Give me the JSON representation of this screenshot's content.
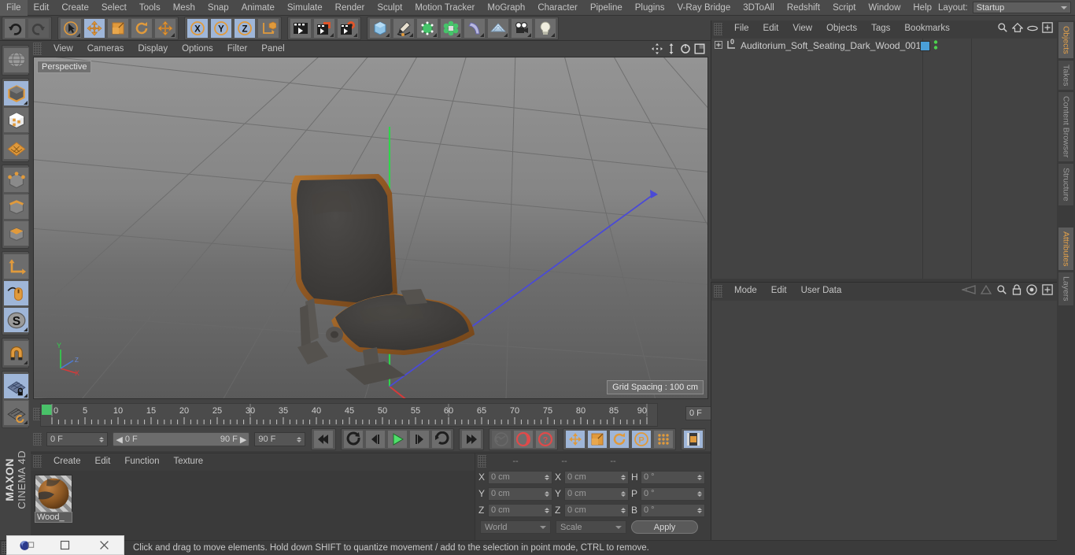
{
  "menubar": {
    "items": [
      "File",
      "Edit",
      "Create",
      "Select",
      "Tools",
      "Mesh",
      "Snap",
      "Animate",
      "Simulate",
      "Render",
      "Sculpt",
      "Motion Tracker",
      "MoGraph",
      "Character",
      "Pipeline",
      "Plugins",
      "V-Ray Bridge",
      "3DToAll",
      "Redshift",
      "Script",
      "Window",
      "Help"
    ],
    "layout_label": "Layout:",
    "layout_value": "Startup",
    "search_icon": "search-icon"
  },
  "toolbar": {
    "groups": [
      {
        "name": "history",
        "buttons": [
          {
            "icon": "undo-icon",
            "active": false,
            "disabled": false,
            "corner": false
          },
          {
            "icon": "redo-icon",
            "active": false,
            "disabled": true,
            "corner": false
          }
        ]
      },
      {
        "name": "tools",
        "buttons": [
          {
            "icon": "live-selection-icon",
            "active": false,
            "disabled": false,
            "corner": true
          },
          {
            "icon": "move-tool-icon",
            "active": true,
            "disabled": false,
            "corner": false
          },
          {
            "icon": "scale-tool-icon",
            "active": false,
            "disabled": false,
            "corner": false
          },
          {
            "icon": "rotate-tool-icon",
            "active": false,
            "disabled": false,
            "corner": false
          },
          {
            "icon": "move-alt-icon",
            "active": false,
            "disabled": false,
            "corner": true
          }
        ]
      },
      {
        "name": "axis-locks",
        "buttons": [
          {
            "icon": "axis-x-icon",
            "active": true,
            "disabled": false,
            "corner": false
          },
          {
            "icon": "axis-y-icon",
            "active": true,
            "disabled": false,
            "corner": false
          },
          {
            "icon": "axis-z-icon",
            "active": true,
            "disabled": false,
            "corner": false
          },
          {
            "icon": "world-coordinate-icon",
            "active": false,
            "disabled": false,
            "corner": false
          }
        ]
      },
      {
        "name": "render",
        "buttons": [
          {
            "icon": "render-view-icon",
            "active": false,
            "disabled": false,
            "corner": false
          },
          {
            "icon": "render-to-picture-viewer-icon",
            "active": false,
            "disabled": false,
            "corner": true
          },
          {
            "icon": "render-settings-icon",
            "active": false,
            "disabled": false,
            "corner": true
          }
        ]
      },
      {
        "name": "objects",
        "buttons": [
          {
            "icon": "cube-primitive-icon",
            "active": false,
            "disabled": false,
            "corner": true
          },
          {
            "icon": "spline-pen-icon",
            "active": false,
            "disabled": false,
            "corner": true
          },
          {
            "icon": "generator-nurbs-icon",
            "active": false,
            "disabled": false,
            "corner": true
          },
          {
            "icon": "mograph-cloner-icon",
            "active": false,
            "disabled": false,
            "corner": true
          },
          {
            "icon": "deformer-bend-icon",
            "active": false,
            "disabled": false,
            "corner": true
          },
          {
            "icon": "floor-scene-icon",
            "active": false,
            "disabled": false,
            "corner": true
          },
          {
            "icon": "camera-icon",
            "active": false,
            "disabled": false,
            "corner": true
          },
          {
            "icon": "light-icon",
            "active": false,
            "disabled": false,
            "corner": true
          }
        ]
      }
    ]
  },
  "leftbar": {
    "groups": [
      {
        "buttons": [
          {
            "icon": "make-editable-icon",
            "active": false,
            "corner": false
          }
        ]
      },
      {
        "buttons": [
          {
            "icon": "model-mode-icon",
            "active": true,
            "corner": true
          },
          {
            "icon": "texture-mode-icon",
            "active": false,
            "corner": false
          },
          {
            "icon": "polygon-mode-icon",
            "active": false,
            "corner": false
          }
        ]
      },
      {
        "buttons": [
          {
            "icon": "point-mode-icon",
            "active": false,
            "corner": false
          },
          {
            "icon": "edge-mode-icon",
            "active": false,
            "corner": false
          },
          {
            "icon": "polygon-face-mode-icon",
            "active": false,
            "corner": false
          }
        ]
      },
      {
        "buttons": [
          {
            "icon": "object-axis-icon",
            "active": false,
            "corner": false
          },
          {
            "icon": "viewport-solo-icon",
            "active": true,
            "corner": false
          },
          {
            "icon": "enable-snap-icon",
            "active": true,
            "corner": true
          }
        ]
      },
      {
        "buttons": [
          {
            "icon": "magnet-icon",
            "active": false,
            "corner": true
          }
        ]
      },
      {
        "buttons": [
          {
            "icon": "workplane-lock-icon",
            "active": true,
            "corner": true
          },
          {
            "icon": "workplane-rotate-icon",
            "active": false,
            "corner": true
          }
        ]
      }
    ],
    "brand_top": "MAXON",
    "brand_bottom": "CINEMA 4D"
  },
  "viewport": {
    "menu_items": [
      "View",
      "Cameras",
      "Display",
      "Options",
      "Filter",
      "Panel"
    ],
    "nav_icons": [
      "pan-viewport-icon",
      "zoom-viewport-icon",
      "rotate-viewport-icon",
      "maximize-viewport-icon"
    ],
    "label": "Perspective",
    "grid_spacing": "Grid Spacing : 100 cm",
    "axis_labels": {
      "y": "Y",
      "z": "Z",
      "x": "X"
    }
  },
  "timeline": {
    "ticks": [
      0,
      5,
      10,
      15,
      20,
      25,
      30,
      35,
      40,
      45,
      50,
      55,
      60,
      65,
      70,
      75,
      80,
      85,
      90
    ],
    "current_frame_field": "0 F"
  },
  "transport": {
    "current_frame": "0 F",
    "range_start": "0 F",
    "range_end": "90 F",
    "end_frame": "90 F",
    "buttons": [
      {
        "icon": "go-to-start-icon",
        "active": false,
        "disabled": false
      },
      {
        "icon": "previous-keyframe-icon",
        "active": false,
        "disabled": false
      },
      {
        "icon": "step-back-icon",
        "active": false,
        "disabled": false
      },
      {
        "icon": "play-icon",
        "active": false,
        "disabled": false
      },
      {
        "icon": "step-forward-icon",
        "active": false,
        "disabled": false
      },
      {
        "icon": "next-keyframe-icon",
        "active": false,
        "disabled": false
      },
      {
        "icon": "go-to-end-icon",
        "active": false,
        "disabled": false
      },
      {
        "icon": "record-key-icon",
        "active": false,
        "disabled": true
      },
      {
        "icon": "autokeying-icon",
        "active": false,
        "disabled": false
      },
      {
        "icon": "keyframe-selection-icon",
        "active": false,
        "disabled": false
      },
      {
        "icon": "key-position-icon",
        "active": true,
        "disabled": false
      },
      {
        "icon": "key-scale-icon",
        "active": true,
        "disabled": false
      },
      {
        "icon": "key-rotation-icon",
        "active": true,
        "disabled": false
      },
      {
        "icon": "key-parameter-icon",
        "active": true,
        "disabled": false
      },
      {
        "icon": "key-pla-icon",
        "active": false,
        "disabled": false
      },
      {
        "icon": "timeline-toggle-icon",
        "active": true,
        "disabled": false
      }
    ]
  },
  "materials": {
    "menu_items": [
      "Create",
      "Edit",
      "Function",
      "Texture"
    ],
    "list": [
      {
        "name": "Wood_",
        "preview": "wood-sphere-preview"
      }
    ]
  },
  "coordinates": {
    "headers": [
      "--",
      "--",
      "--"
    ],
    "rows": [
      {
        "pos_label": "X",
        "pos_value": "0 cm",
        "size_label": "X",
        "size_value": "0 cm",
        "rot_label": "H",
        "rot_value": "0 °"
      },
      {
        "pos_label": "Y",
        "pos_value": "0 cm",
        "size_label": "Y",
        "size_value": "0 cm",
        "rot_label": "P",
        "rot_value": "0 °"
      },
      {
        "pos_label": "Z",
        "pos_value": "0 cm",
        "size_label": "Z",
        "size_value": "0 cm",
        "rot_label": "B",
        "rot_value": "0 °"
      }
    ],
    "system": "World",
    "mode": "Scale",
    "apply_label": "Apply"
  },
  "objects_panel": {
    "menu_items": [
      "File",
      "Edit",
      "View",
      "Objects",
      "Tags",
      "Bookmarks"
    ],
    "header_icons": [
      "search-icon",
      "home-icon",
      "ellipse-icon",
      "add-layer-icon"
    ],
    "items": [
      {
        "name": "Auditorium_Soft_Seating_Dark_Wood_001",
        "level_badge": "0",
        "tag_color": "#4a9fd8",
        "visibility_dots": 2
      }
    ]
  },
  "attributes_panel": {
    "menu_items": [
      "Mode",
      "Edit",
      "User Data"
    ],
    "header_icons": [
      "back-history-icon",
      "forward-history-icon",
      "search-icon",
      "lock-icon",
      "target-icon",
      "add-tab-icon"
    ]
  },
  "right_tabs": [
    {
      "label": "Objects",
      "active": true
    },
    {
      "label": "Takes",
      "active": false
    },
    {
      "label": "Content Browser",
      "active": false
    },
    {
      "label": "Structure",
      "active": false
    },
    {
      "label": "Attributes",
      "active": true
    },
    {
      "label": "Layers",
      "active": false
    }
  ],
  "status": {
    "text": "Click and drag to move elements. Hold down SHIFT to quantize movement / add to the selection in point mode, CTRL to remove."
  },
  "taskbar": {
    "app_icon": "cinema4d-app-icon",
    "restore_icon": "restore-window-icon",
    "minimize_icon": "minimize-window-icon",
    "close_icon": "close-window-icon"
  },
  "colors": {
    "accent_orange": "#e09a3c",
    "active_blue": "#9fb6d8",
    "axis_y_green": "#2fd44a",
    "axis_x_red": "#d63a3a",
    "axis_z_blue": "#4a4ad6",
    "panel_bg": "#434343"
  }
}
